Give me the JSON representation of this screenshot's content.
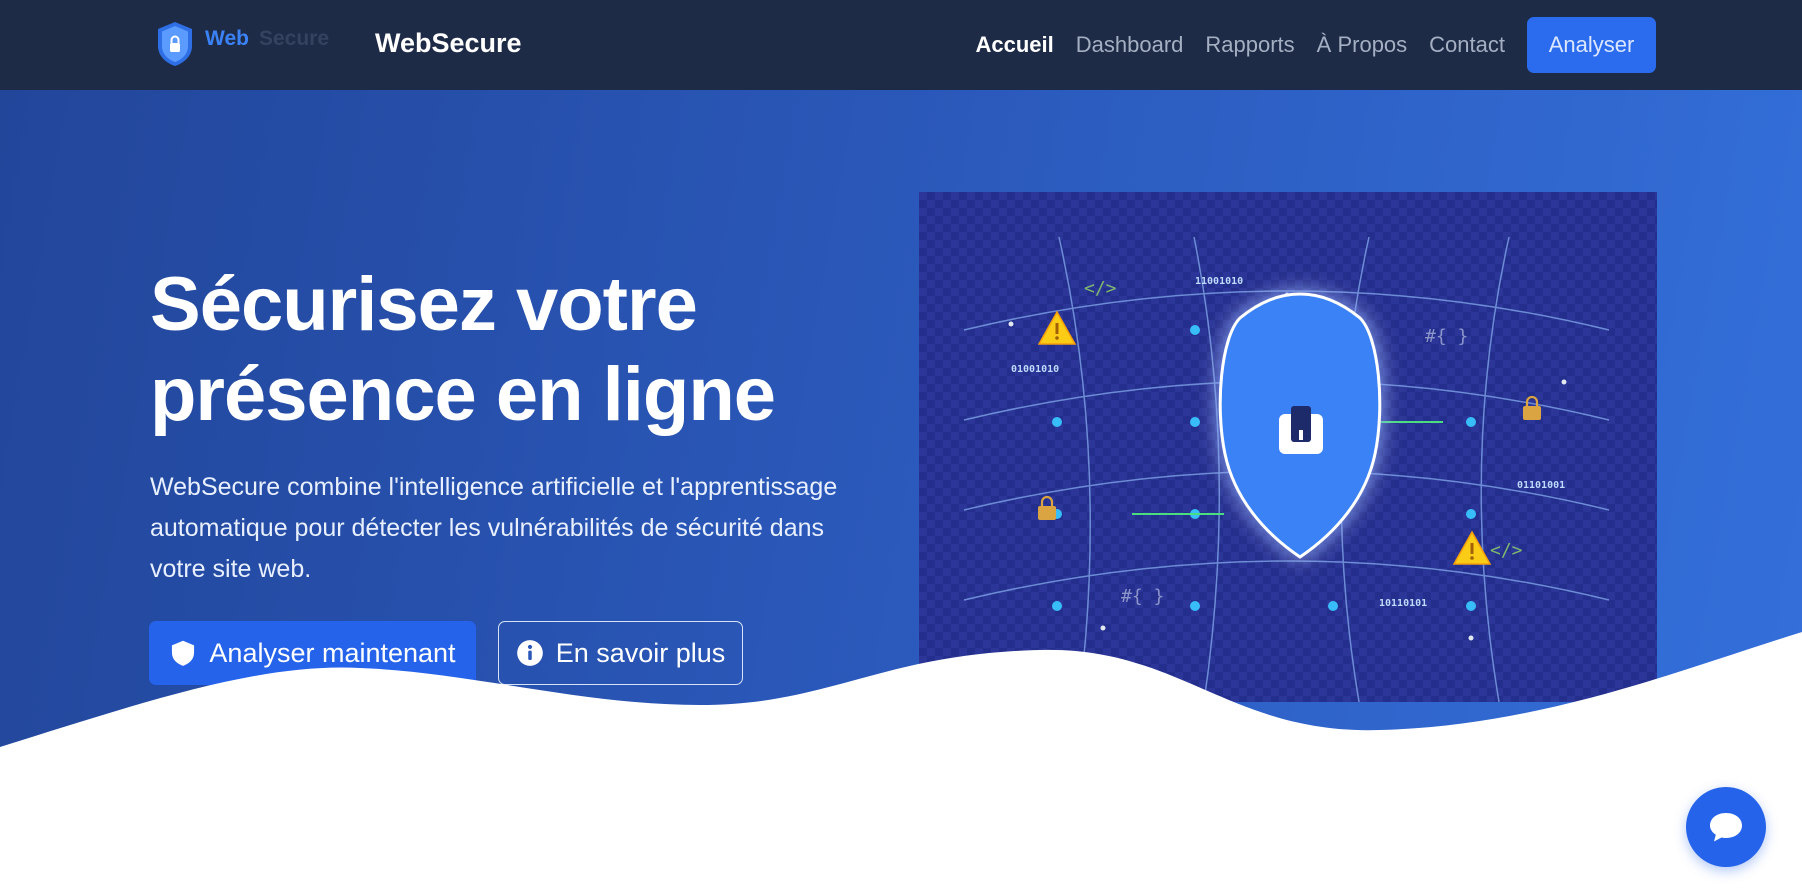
{
  "nav": {
    "logo_word_1": "Web",
    "logo_word_2": "Secure",
    "brand": "WebSecure",
    "links": [
      "Accueil",
      "Dashboard",
      "Rapports",
      "À Propos",
      "Contact"
    ],
    "active_link": "Accueil",
    "cta": "Analyser"
  },
  "hero": {
    "title_line1": "Sécurisez votre",
    "title_line2": "présence en ligne",
    "description": "WebSecure combine l'intelligence artificielle et l'apprentissage automatique pour détecter les vulnérabilités de sécurité dans votre site web.",
    "primary_button": "Analyser maintenant",
    "secondary_button": "En savoir plus"
  },
  "illustration": {
    "binary_1": "11001010",
    "binary_2": "01001010",
    "binary_3": "01101001",
    "binary_4": "10110101",
    "code_tag_1": "</>",
    "code_tag_2": "</>",
    "hash_braces_1": "#{ }",
    "hash_braces_2": "#{ }"
  },
  "icons": {
    "logo": "shield-lock-icon",
    "primary_button_icon": "shield-icon",
    "secondary_button_icon": "info-circle-icon",
    "chat": "chat-bubble-icon"
  },
  "colors": {
    "navbar": "#1e2b47",
    "accent": "#2563eb",
    "hero_start": "#22469a",
    "hero_end": "#3470db",
    "illustration_bg": "#242e8c",
    "shield": "#3b82f6",
    "warning": "#facc15"
  }
}
